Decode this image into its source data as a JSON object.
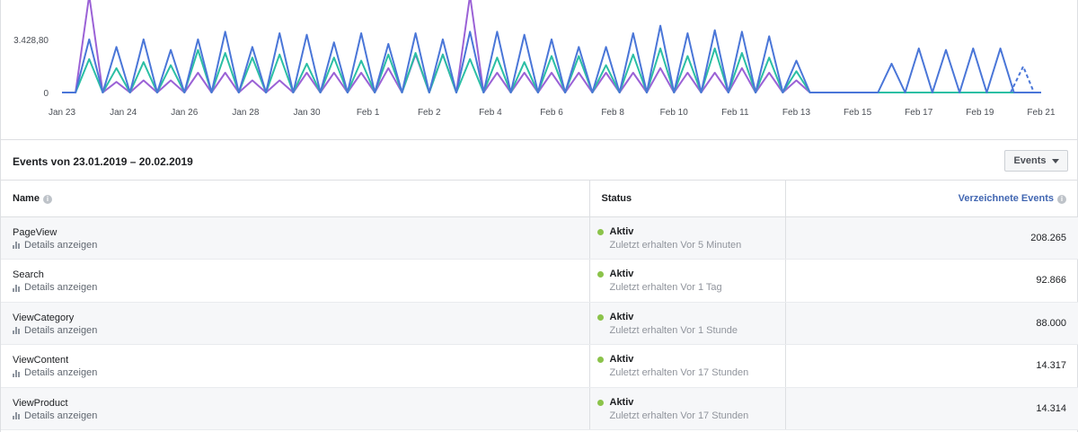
{
  "chart_data": {
    "type": "line",
    "y_ticks": [
      "0",
      "3.428,80"
    ],
    "x_labels": [
      "Jan 23",
      "Jan 24",
      "Jan 26",
      "Jan 28",
      "Jan 30",
      "Feb 1",
      "Feb 2",
      "Feb 4",
      "Feb 6",
      "Feb 8",
      "Feb 10",
      "Feb 11",
      "Feb 13",
      "Feb 15",
      "Feb 17",
      "Feb 19",
      "Feb 21"
    ],
    "colors": [
      "#4a76d8",
      "#2bbfa4",
      "#9b62d6"
    ],
    "series": [
      {
        "values": [
          0,
          0,
          3500,
          0,
          3000,
          0,
          3500,
          0,
          2800,
          0,
          3500,
          0,
          4000,
          0,
          3000,
          0,
          3900,
          0,
          3800,
          0,
          3300,
          0,
          3900,
          0,
          3200,
          0,
          3900,
          0,
          3500,
          0,
          4000,
          0,
          4000,
          0,
          3800,
          0,
          3500,
          0,
          3000,
          0,
          3000,
          0,
          3900,
          0,
          4400,
          0,
          3900,
          0,
          4100,
          0,
          4000,
          0,
          3700,
          0,
          2100,
          0,
          0,
          0,
          0,
          0,
          0,
          1900,
          0,
          2900,
          0,
          2800,
          0,
          2900,
          0,
          2900,
          0,
          0,
          0
        ]
      },
      {
        "values": [
          0,
          0,
          2200,
          0,
          1600,
          0,
          2000,
          0,
          1800,
          0,
          2800,
          0,
          2600,
          0,
          2300,
          0,
          2500,
          0,
          1900,
          0,
          2300,
          0,
          2100,
          0,
          2500,
          0,
          2600,
          0,
          2500,
          0,
          2200,
          0,
          2300,
          0,
          2000,
          0,
          2400,
          0,
          2400,
          0,
          1800,
          0,
          2500,
          0,
          2900,
          0,
          2400,
          0,
          2900,
          0,
          2600,
          0,
          2300,
          0,
          1400,
          0,
          0,
          0,
          0,
          0,
          0,
          0,
          0,
          0,
          0,
          0,
          0,
          0,
          0,
          0,
          0,
          0,
          0
        ]
      },
      {
        "values": [
          0,
          0,
          9000,
          0,
          700,
          0,
          800,
          0,
          800,
          0,
          1300,
          0,
          1300,
          0,
          800,
          0,
          800,
          0,
          1300,
          0,
          1300,
          0,
          1300,
          0,
          1600,
          0,
          2500,
          0,
          2500,
          0,
          9000,
          0,
          1300,
          0,
          1300,
          0,
          1300,
          0,
          1300,
          0,
          1300,
          0,
          1300,
          0,
          1600,
          0,
          1300,
          0,
          1300,
          0,
          1600,
          0,
          1300,
          0,
          800,
          0,
          0,
          0,
          0,
          0,
          0,
          0,
          0,
          0,
          0,
          0,
          0,
          0,
          0,
          0,
          0,
          0,
          0
        ]
      }
    ]
  },
  "header": {
    "title": "Events von 23.01.2019 – 20.02.2019",
    "dropdown_label": "Events"
  },
  "table": {
    "col_name": "Name",
    "col_status": "Status",
    "col_events": "Verzeichnete Events",
    "info_glyph": "i",
    "rows": [
      {
        "name": "PageView",
        "details": "Details anzeigen",
        "status": "Aktiv",
        "status_sub": "Zuletzt erhalten Vor 5 Minuten",
        "count": "208.265"
      },
      {
        "name": "Search",
        "details": "Details anzeigen",
        "status": "Aktiv",
        "status_sub": "Zuletzt erhalten Vor 1 Tag",
        "count": "92.866"
      },
      {
        "name": "ViewCategory",
        "details": "Details anzeigen",
        "status": "Aktiv",
        "status_sub": "Zuletzt erhalten Vor 1 Stunde",
        "count": "88.000"
      },
      {
        "name": "ViewContent",
        "details": "Details anzeigen",
        "status": "Aktiv",
        "status_sub": "Zuletzt erhalten Vor 17 Stunden",
        "count": "14.317"
      },
      {
        "name": "ViewProduct",
        "details": "Details anzeigen",
        "status": "Aktiv",
        "status_sub": "Zuletzt erhalten Vor 17 Stunden",
        "count": "14.314"
      }
    ]
  }
}
